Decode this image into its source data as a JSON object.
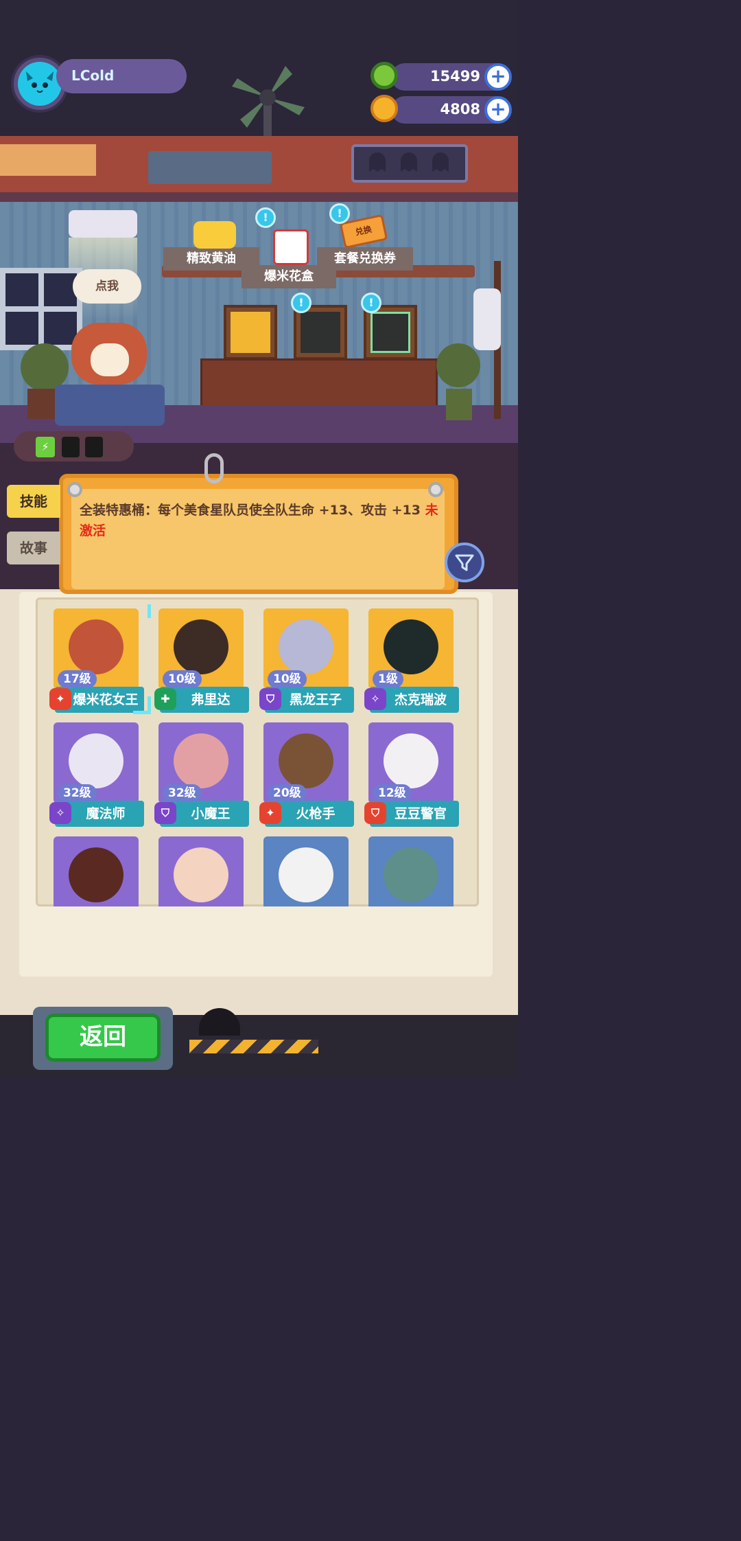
{
  "player": {
    "name": "LCold"
  },
  "currencies": [
    {
      "icon": "donut-coin-icon",
      "value": "15499"
    },
    {
      "icon": "planet-coin-icon",
      "value": "4808"
    }
  ],
  "room": {
    "shelf_labels": [
      "精致黄油",
      "爆米花盒",
      "套餐兑换券"
    ],
    "ticket_badge": "兑换",
    "speech_bubble": "点我",
    "info_icon": "!"
  },
  "side_tabs": [
    {
      "label": "技能",
      "active": true
    },
    {
      "label": "故事",
      "active": false
    }
  ],
  "notice": {
    "text": "全装特惠桶：每个美食星队员使全队生命 +13、攻击 +13",
    "status": "未激活"
  },
  "filter_icon": "filter-icon",
  "characters": [
    {
      "level": "17级",
      "name": "爆米花女王",
      "role": "attack",
      "bg": "gold",
      "selected": true
    },
    {
      "level": "10级",
      "name": "弗里达",
      "role": "heal",
      "bg": "gold"
    },
    {
      "level": "10级",
      "name": "黑龙王子",
      "role": "defense",
      "bg": "gold"
    },
    {
      "level": "1级",
      "name": "杰克瑞波",
      "role": "magic",
      "bg": "gold"
    },
    {
      "level": "32级",
      "name": "魔法师",
      "role": "magic",
      "bg": "purple"
    },
    {
      "level": "32级",
      "name": "小魔王",
      "role": "defense",
      "bg": "purple"
    },
    {
      "level": "20级",
      "name": "火枪手",
      "role": "attack",
      "bg": "purple"
    },
    {
      "level": "12级",
      "name": "豆豆警官",
      "role": "defense-red",
      "bg": "purple"
    },
    {
      "level": "",
      "name": "",
      "role": "",
      "bg": "purple"
    },
    {
      "level": "",
      "name": "",
      "role": "",
      "bg": "purple"
    },
    {
      "level": "",
      "name": "",
      "role": "",
      "bg": "blue"
    },
    {
      "level": "",
      "name": "",
      "role": "",
      "bg": "blue"
    }
  ],
  "buttons": {
    "back": "返回"
  },
  "colors": {
    "accent_teal": "#2aa3b4",
    "notice_orange": "#f3a536",
    "inactive_red": "#e52a1a",
    "back_green": "#36c84a"
  }
}
